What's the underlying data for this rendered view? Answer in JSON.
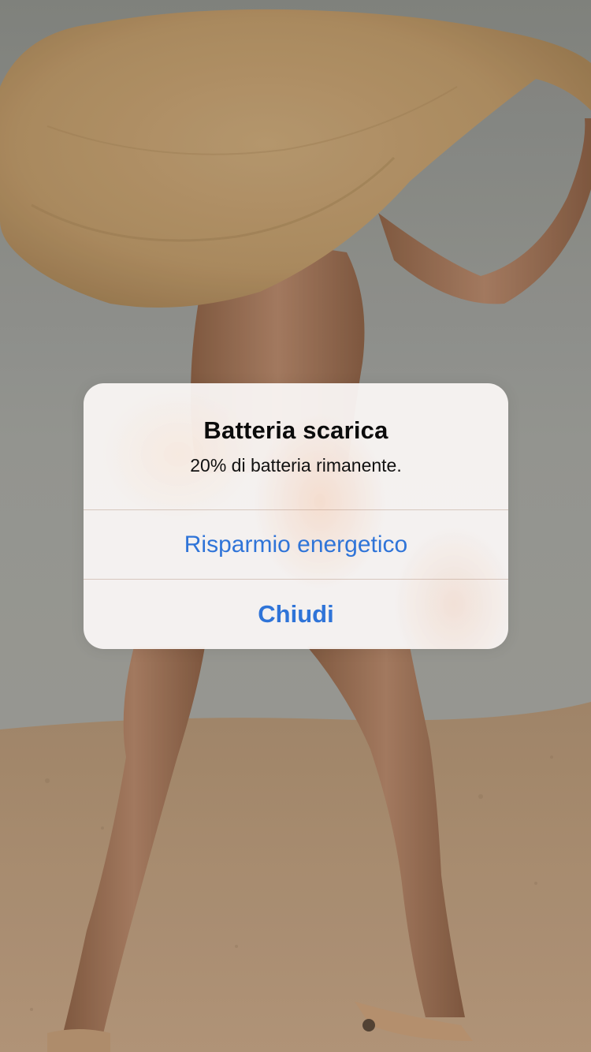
{
  "alert": {
    "title": "Batteria scarica",
    "message": "20% di batteria rimanente.",
    "actions": [
      {
        "label": "Risparmio energetico",
        "style": "default"
      },
      {
        "label": "Chiudi",
        "style": "preferred"
      }
    ]
  },
  "colors": {
    "action_text": "#2f74d8",
    "title_text": "#0b0b0b",
    "alert_background": "#faf7f5",
    "wallpaper_sky": "#9b9d97",
    "wallpaper_sand": "#b89a7a"
  },
  "wallpaper": {
    "subject": "person walking on sand wearing a large straw hat"
  }
}
